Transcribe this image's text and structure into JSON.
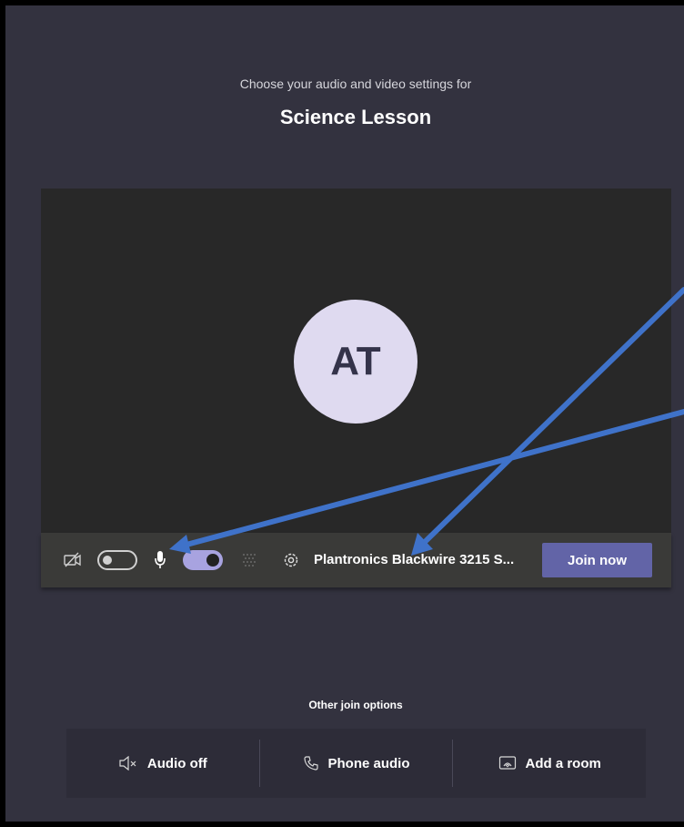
{
  "header": {
    "subtitle": "Choose your audio and video settings for",
    "meeting_title": "Science Lesson"
  },
  "avatar": {
    "initials": "AT"
  },
  "controls": {
    "camera_on": false,
    "mic_on": true,
    "device_label": "Plantronics Blackwire 3215 S...",
    "join_label": "Join now"
  },
  "other_options": {
    "label": "Other join options",
    "items": [
      {
        "label": "Audio off",
        "icon": "speaker-muted-icon"
      },
      {
        "label": "Phone audio",
        "icon": "phone-icon"
      },
      {
        "label": "Add a room",
        "icon": "cast-room-icon"
      }
    ]
  },
  "colors": {
    "background": "#33323f",
    "preview": "#282828",
    "accent": "#6264a7",
    "toggle_on": "#a8a3e0",
    "annotation_arrow": "#3f72c9"
  }
}
